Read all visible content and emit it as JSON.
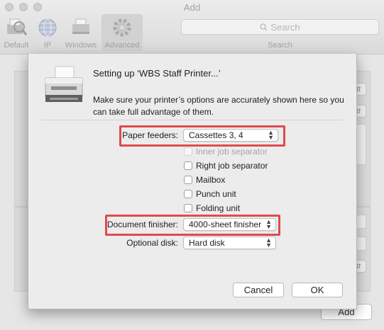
{
  "window": {
    "title": "Add",
    "toolbar": [
      {
        "label": "Default",
        "icon": "default-printer-icon"
      },
      {
        "label": "IP",
        "icon": "globe-icon"
      },
      {
        "label": "Windows",
        "icon": "windows-printer-icon"
      },
      {
        "label": "Advanced",
        "icon": "gear-icon"
      }
    ],
    "search": {
      "placeholder": "Search",
      "label": "Search"
    },
    "add_button": "Add"
  },
  "sheet": {
    "title": "Setting up ‘WBS Staff Printer...’",
    "description": "Make sure your printer’s options are accurately shown here so you can take full advantage of them.",
    "paper_feeders": {
      "label": "Paper feeders:",
      "value": "Cassettes 3, 4"
    },
    "options": [
      {
        "label": "Inner job separator",
        "checked": false,
        "enabled": false
      },
      {
        "label": "Right job separator",
        "checked": false,
        "enabled": true
      },
      {
        "label": "Mailbox",
        "checked": false,
        "enabled": true
      },
      {
        "label": "Punch unit",
        "checked": false,
        "enabled": true
      },
      {
        "label": "Folding unit",
        "checked": false,
        "enabled": true
      }
    ],
    "document_finisher": {
      "label": "Document finisher:",
      "value": "4000-sheet finisher"
    },
    "optional_disk": {
      "label": "Optional disk:",
      "value": "Hard disk"
    },
    "cancel_label": "Cancel",
    "ok_label": "OK"
  },
  "colors": {
    "highlight": "#e04a4f",
    "sheet_bg": "#ececec"
  }
}
